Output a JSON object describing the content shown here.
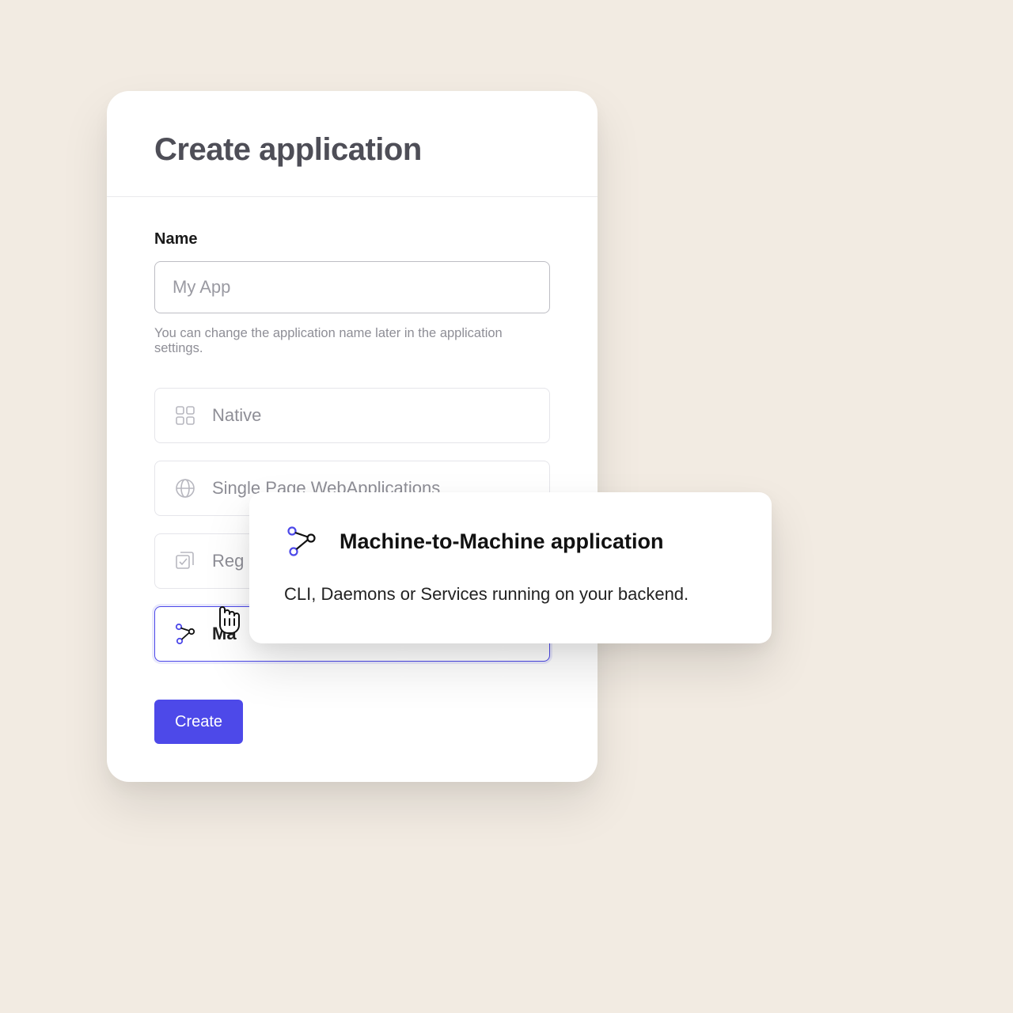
{
  "card": {
    "title": "Create application",
    "name_field": {
      "label": "Name",
      "placeholder": "My App",
      "help": "You can change the application name later in the application settings."
    },
    "options": [
      {
        "label": "Native",
        "icon": "grid-icon"
      },
      {
        "label": "Single Page WebApplications",
        "icon": "globe-icon"
      },
      {
        "label": "Reg",
        "icon": "checkboxes-icon"
      },
      {
        "label": "Ma",
        "icon": "nodes-icon",
        "selected": true
      }
    ],
    "create_label": "Create"
  },
  "tooltip": {
    "title": "Machine-to-Machine application",
    "description": "CLI, Daemons or Services running on your backend."
  }
}
